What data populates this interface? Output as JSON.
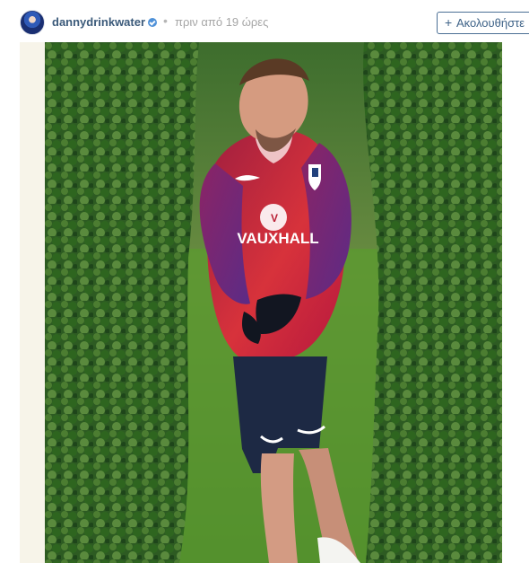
{
  "post": {
    "username": "dannydrinkwater",
    "separator": "•",
    "timestamp": "πριν από 19 ώρες",
    "follow_button": "Ακολουθήστε",
    "follow_icon": "+"
  },
  "icons": {
    "verified": "verified-badge-icon",
    "avatar": "profile-avatar"
  },
  "colors": {
    "username": "#3b5a7a",
    "timestamp": "#a6a6a6",
    "follow_border": "#4b6f95",
    "verified": "#4f91d8"
  }
}
